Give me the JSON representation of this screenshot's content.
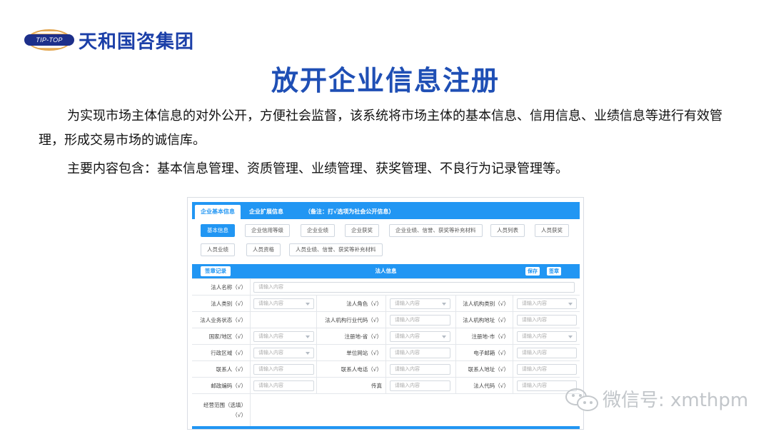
{
  "brand": {
    "logo_band": "TIP-TOP",
    "company": "天和国咨集团"
  },
  "title": "放开企业信息注册",
  "intro": {
    "p1": "为实现市场主体信息的对外公开，方便社会监督，该系统将市场主体的基本信息、信用信息、业绩信息等进行有效管理，形成交易市场的诚信库。",
    "p2": "主要内容包含：基本信息管理、资质管理、业绩管理、获奖管理、不良行为记录管理等。"
  },
  "app": {
    "tabs": [
      "企业基本信息",
      "企业扩展信息",
      "（备注：打√选项为社会公开信息）"
    ],
    "chips_row1": [
      "基本信息",
      "企业信用等级",
      "企业业绩",
      "企业获奖",
      "企业业绩、信誉、获奖等补充材料",
      "人员列表",
      "人员获奖"
    ],
    "chips_row2": [
      "人员业绩",
      "人员资格",
      "人员业绩、信誉、获奖等补充材料"
    ],
    "section": {
      "records_button": "签章记录",
      "title": "法人信息",
      "save_button": "保存",
      "sign_button": "签章"
    },
    "placeholder": "请输入内容",
    "fields": {
      "name": "法人名称（√）",
      "type": "法人类别（√）",
      "role": "法人角色（√）",
      "org_type": "法人机构类别（√）",
      "status": "法人业务状态（√）",
      "industry_code": "法人机构行业代码（√）",
      "org_address": "法人机构地址（√）",
      "country": "国家/地区（√）",
      "province": "注册地-省（√）",
      "city": "注册地-市（√）",
      "district": "行政区域（√）",
      "website": "单位网站（√）",
      "email": "电子邮箱（√）",
      "contact": "联系人（√）",
      "phone": "联系人电话（√）",
      "contact_address": "联系人地址（√）",
      "postcode": "邮政编码（√）",
      "fax": "传真",
      "legal_code": "法人代码（√）",
      "scope_line1": "经营范围（选填）",
      "scope_line2": "（√）"
    }
  },
  "watermark": "微信号: xmthpm",
  "colors": {
    "title_blue": "#1f4fb5",
    "app_blue": "#2196f3"
  }
}
